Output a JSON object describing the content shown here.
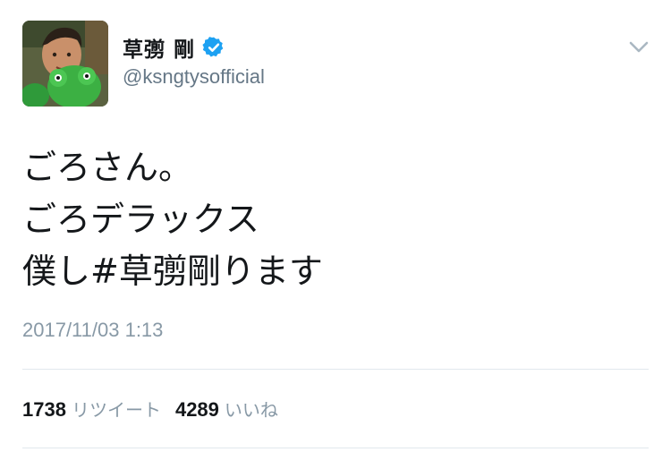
{
  "tweet": {
    "author": {
      "display_name": "草彅 剛",
      "handle": "@ksngtysofficial",
      "verified": true,
      "verified_color": "#1da1f2"
    },
    "text_lines": [
      "ごろさん。",
      "ごろデラックス",
      "僕し"
    ],
    "hashtag": "#草彅剛",
    "text_after_hashtag": "ります",
    "timestamp": "2017/11/03 1:13",
    "stats": {
      "retweets_count": "1738",
      "retweets_label": "リツイート",
      "likes_count": "4289",
      "likes_label": "いいね"
    }
  }
}
